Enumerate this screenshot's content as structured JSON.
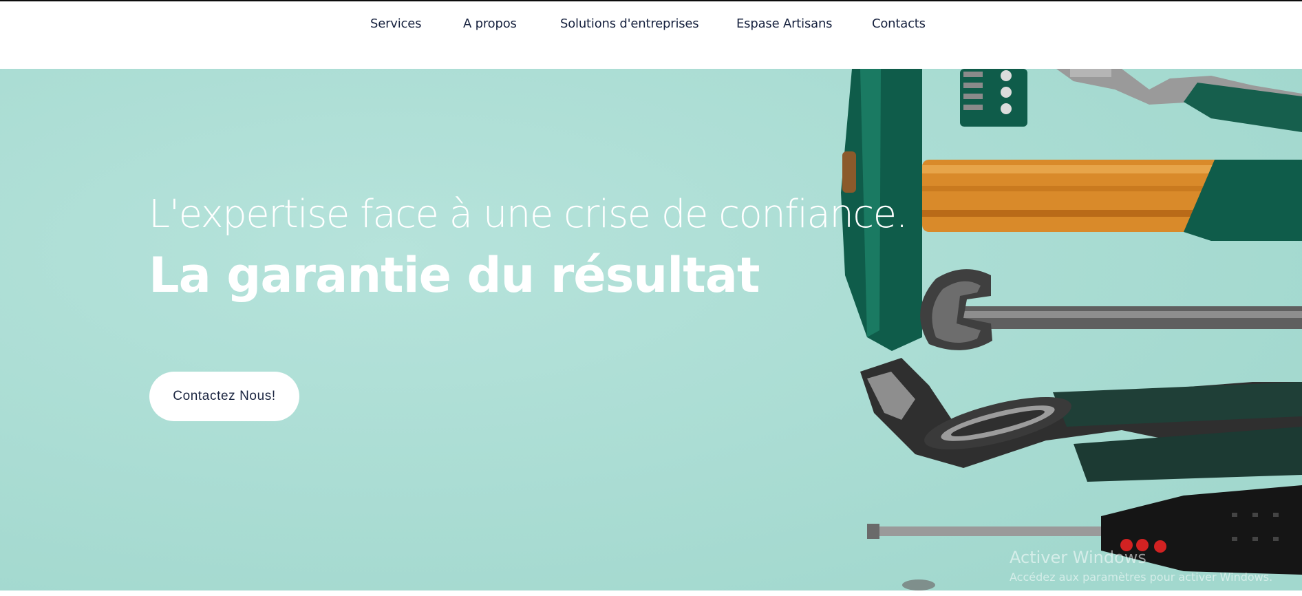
{
  "nav": {
    "items": [
      {
        "label": "Services"
      },
      {
        "label": "A propos"
      },
      {
        "label": "Solutions d'entreprises"
      },
      {
        "label": "Espase Artisans"
      },
      {
        "label": "Contacts"
      }
    ]
  },
  "hero": {
    "tagline": "L'expertise face à une crise de confiance.",
    "headline": "La garantie du résultat",
    "cta_label": "Contactez Nous!",
    "background_color": "#a9ddd4",
    "image_icons": [
      "hammer-icon",
      "bit-set-icon",
      "pliers-icon",
      "wrench-icon",
      "water-pump-pliers-icon",
      "screwdriver-icon"
    ]
  },
  "watermark": {
    "title": "Activer Windows",
    "subtitle": "Accédez aux paramètres pour activer Windows."
  },
  "colors": {
    "nav_text": "#16213e",
    "hero_bg": "#a9ddd4",
    "tool_green": "#0f5c4a",
    "handle_wood": "#d98a2a"
  }
}
